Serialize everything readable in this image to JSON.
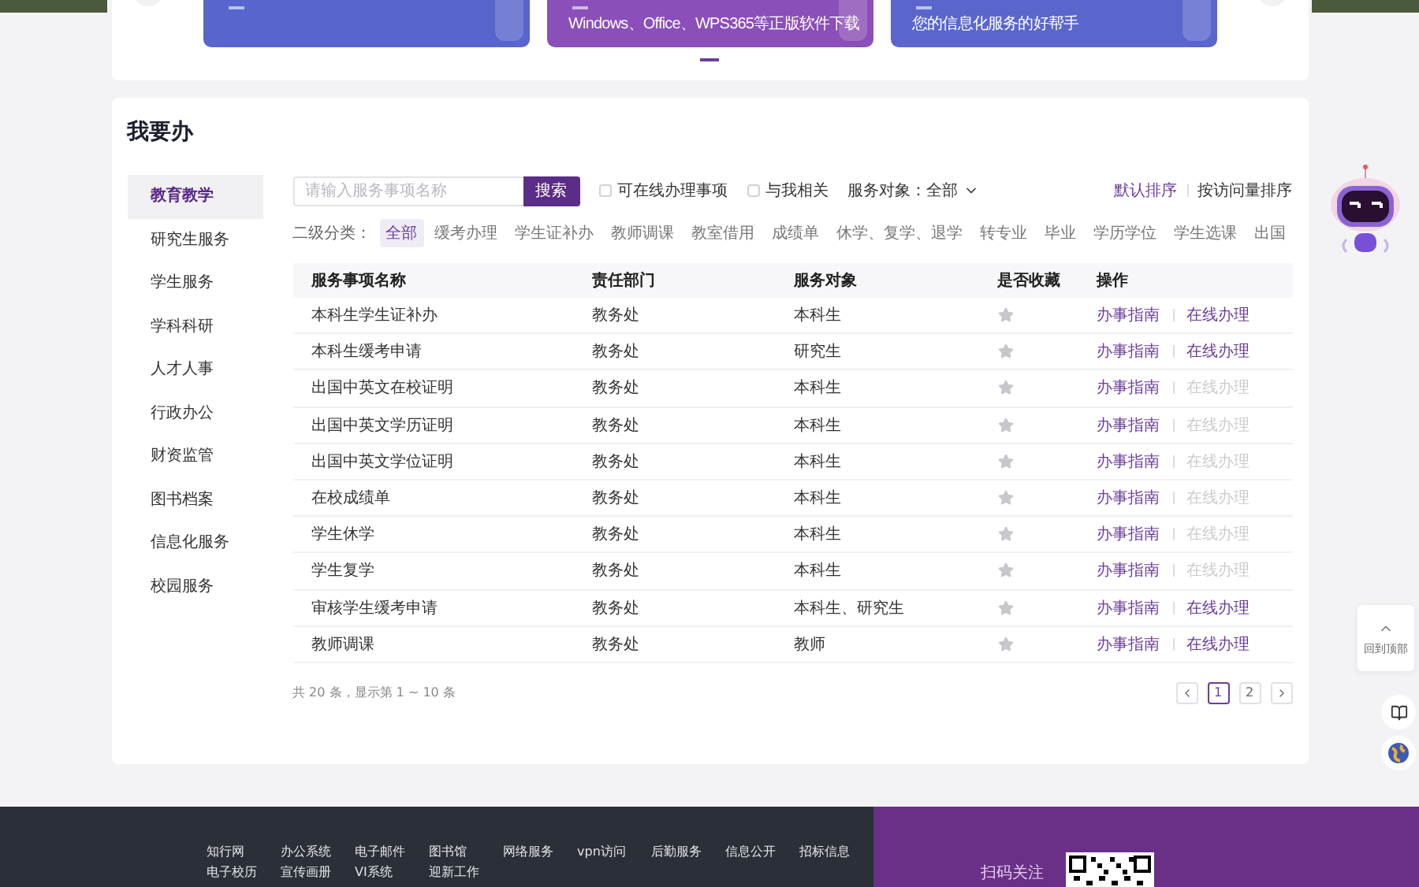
{
  "banners": [
    {
      "color": "#5765cc"
    },
    {
      "color": "#8a4fb8",
      "caption": "Windows、Office、WPS365等正版软件下载"
    },
    {
      "color": "#5a66cc",
      "caption": "您的信息化服务的好帮手"
    }
  ],
  "panel": {
    "title": "我要办"
  },
  "sidebar": {
    "items": [
      {
        "label": "教育教学",
        "selected": true
      },
      {
        "label": "研究生服务",
        "selected": false
      },
      {
        "label": "学生服务",
        "selected": false
      },
      {
        "label": "学科科研",
        "selected": false
      },
      {
        "label": "人才人事",
        "selected": false
      },
      {
        "label": "行政办公",
        "selected": false
      },
      {
        "label": "财资监管",
        "selected": false
      },
      {
        "label": "图书档案",
        "selected": false
      },
      {
        "label": "信息化服务",
        "selected": false
      },
      {
        "label": "校园服务",
        "selected": false
      }
    ]
  },
  "search": {
    "placeholder": "请输入服务事项名称",
    "button": "搜索"
  },
  "filters": [
    {
      "label": "可在线办理事项",
      "checked": false
    },
    {
      "label": "与我相关",
      "checked": false
    }
  ],
  "audience": {
    "label": "服务对象：",
    "value": "全部"
  },
  "sort": [
    {
      "label": "默认排序",
      "selected": true
    },
    {
      "label": "按访问量排序",
      "selected": false
    }
  ],
  "categories": {
    "label": "二级分类：",
    "items": [
      {
        "label": "全部",
        "selected": true
      },
      {
        "label": "缓考办理",
        "selected": false
      },
      {
        "label": "学生证补办",
        "selected": false
      },
      {
        "label": "教师调课",
        "selected": false
      },
      {
        "label": "教室借用",
        "selected": false
      },
      {
        "label": "成绩单",
        "selected": false
      },
      {
        "label": "休学、复学、退学",
        "selected": false
      },
      {
        "label": "转专业",
        "selected": false
      },
      {
        "label": "毕业",
        "selected": false
      },
      {
        "label": "学历学位",
        "selected": false
      },
      {
        "label": "学生选课",
        "selected": false
      },
      {
        "label": "出国",
        "selected": false
      }
    ]
  },
  "table": {
    "columns": [
      "服务事项名称",
      "责任部门",
      "服务对象",
      "是否收藏",
      "操作"
    ],
    "rows": [
      {
        "name": "本科生学生证补办",
        "dept": "教务处",
        "target": "本科生",
        "favorite": false,
        "guide": "办事指南",
        "online": "在线办理",
        "online_enabled": true
      },
      {
        "name": "本科生缓考申请",
        "dept": "教务处",
        "target": "研究生",
        "favorite": false,
        "guide": "办事指南",
        "online": "在线办理",
        "online_enabled": true
      },
      {
        "name": "出国中英文在校证明",
        "dept": "教务处",
        "target": "本科生",
        "favorite": false,
        "guide": "办事指南",
        "online": "在线办理",
        "online_enabled": false
      },
      {
        "name": "出国中英文学历证明",
        "dept": "教务处",
        "target": "本科生",
        "favorite": false,
        "guide": "办事指南",
        "online": "在线办理",
        "online_enabled": false
      },
      {
        "name": "出国中英文学位证明",
        "dept": "教务处",
        "target": "本科生",
        "favorite": false,
        "guide": "办事指南",
        "online": "在线办理",
        "online_enabled": false
      },
      {
        "name": "在校成绩单",
        "dept": "教务处",
        "target": "本科生",
        "favorite": false,
        "guide": "办事指南",
        "online": "在线办理",
        "online_enabled": false
      },
      {
        "name": "学生休学",
        "dept": "教务处",
        "target": "本科生",
        "favorite": false,
        "guide": "办事指南",
        "online": "在线办理",
        "online_enabled": false
      },
      {
        "name": "学生复学",
        "dept": "教务处",
        "target": "本科生",
        "favorite": false,
        "guide": "办事指南",
        "online": "在线办理",
        "online_enabled": false
      },
      {
        "name": "审核学生缓考申请",
        "dept": "教务处",
        "target": "本科生、研究生",
        "favorite": false,
        "guide": "办事指南",
        "online": "在线办理",
        "online_enabled": true
      },
      {
        "name": "教师调课",
        "dept": "教务处",
        "target": "教师",
        "favorite": false,
        "guide": "办事指南",
        "online": "在线办理",
        "online_enabled": true
      }
    ]
  },
  "pagination": {
    "summary": "共 20 条，显示第 1 ~ 10 条",
    "pages": [
      {
        "label": "1",
        "selected": true
      },
      {
        "label": "2",
        "selected": false
      }
    ]
  },
  "back_to_top": {
    "label": "回到顶部"
  },
  "footer": {
    "links": [
      "知行网",
      "办公系统",
      "电子邮件",
      "图书馆",
      "网络服务",
      "vpn访问",
      "后勤服务",
      "信息公开",
      "招标信息",
      "电子校历",
      "宣传画册",
      "VI系统",
      "迎新工作"
    ],
    "follow": "扫码关注"
  }
}
